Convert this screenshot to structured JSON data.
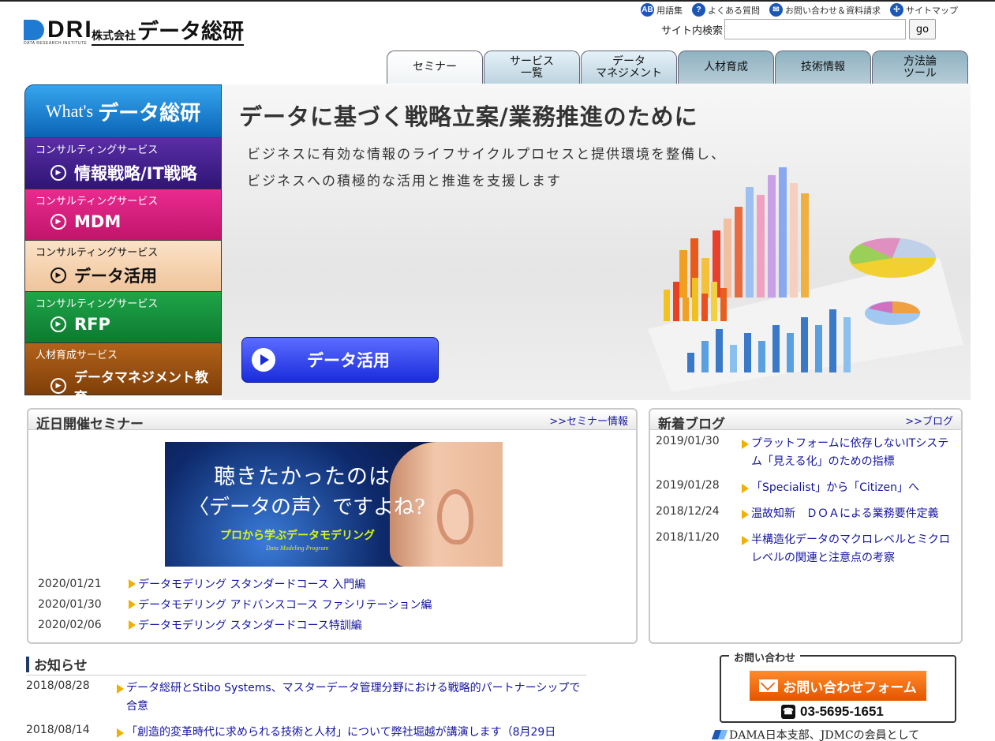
{
  "header": {
    "logo_mark": "DRI",
    "logo_sub": "DATA RESEARCH INSTITUTE",
    "logo_prefix": "株式会社",
    "logo_name": "データ総研",
    "utility": [
      {
        "icon": "ab-glossary-icon",
        "glyph": "AB",
        "label": "用語集"
      },
      {
        "icon": "question-icon",
        "glyph": "?",
        "label": "よくある質問"
      },
      {
        "icon": "mail-icon",
        "glyph": "✉",
        "label": "お問い合わせ＆資料請求"
      },
      {
        "icon": "sitemap-icon",
        "glyph": "✢",
        "label": "サイトマップ"
      }
    ],
    "search": {
      "label": "サイト内検索",
      "value": "",
      "placeholder": "",
      "button": "go"
    }
  },
  "tabs": [
    {
      "label": "セミナー",
      "state": "active"
    },
    {
      "label": "サービス\n一覧",
      "state": "normal"
    },
    {
      "label": "データ\nマネジメント",
      "state": "normal"
    },
    {
      "label": "人材育成",
      "state": "dark"
    },
    {
      "label": "技術情報",
      "state": "dark"
    },
    {
      "label": "方法論\nツール",
      "state": "dark"
    }
  ],
  "leftnav": {
    "whats_prefix": "What's",
    "whats_name": "データ総研",
    "items": [
      {
        "small": "コンサルティングサービス",
        "big": "情報戦略/IT戦略",
        "color": "#3a1f8c"
      },
      {
        "small": "コンサルティングサービス",
        "big": "MDM",
        "color": "#d81b7c"
      },
      {
        "small": "コンサルティングサービス",
        "big": "データ活用",
        "color": "#f5cfa6"
      },
      {
        "small": "コンサルティングサービス",
        "big": "RFP",
        "color": "#169040"
      },
      {
        "small": "人材育成サービス",
        "big": "データマネジメント教育",
        "color": "#9a500f"
      }
    ]
  },
  "hero": {
    "title": "データに基づく戦略立案/業務推進のために",
    "line1": "ビジネスに有効な情報のライフサイクルプロセスと提供環境を整備し、",
    "line2": "ビジネスへの積極的な活用と推進を支援します",
    "button": "データ活用"
  },
  "seminar": {
    "title": "近日開催セミナー",
    "link": ">>セミナー情報",
    "banner": {
      "line1": "聴きたかったのは",
      "line2": "〈データの声〉ですよね?",
      "line3": "プロから学ぶデータモデリング",
      "line4": "Data Modeling Program"
    },
    "items": [
      {
        "date": "2020/01/21",
        "title": "データモデリング スタンダードコース 入門編"
      },
      {
        "date": "2020/01/30",
        "title": "データモデリング アドバンスコース ファシリテーション編"
      },
      {
        "date": "2020/02/06",
        "title": "データモデリング スタンダードコース特訓編"
      }
    ]
  },
  "blog": {
    "title": "新着ブログ",
    "link": ">>ブログ",
    "items": [
      {
        "date": "2019/01/30",
        "title": "プラットフォームに依存しないITシステム「見える化」のための指標"
      },
      {
        "date": "2019/01/28",
        "title": "「Specialist」から「Citizen」へ"
      },
      {
        "date": "2018/12/24",
        "title": "温故知新　ＤＯＡによる業務要件定義"
      },
      {
        "date": "2018/11/20",
        "title": "半構造化データのマクロレベルとミクロレベルの関連と注意点の考察"
      }
    ]
  },
  "news": {
    "title": "お知らせ",
    "items": [
      {
        "date": "2018/08/28",
        "title": "データ総研とStibo Systems、マスターデータ管理分野における戦略的パートナーシップで合意"
      },
      {
        "date": "2018/08/14",
        "title": "「創造的変革時代に求められる技術と人材」について弊社堀越が講演します（8月29日"
      }
    ]
  },
  "contact": {
    "legend": "お問い合わせ",
    "form_button": "お問い合わせフォーム",
    "phone": "03-5695-1651"
  },
  "dama": "DAMA日本支部、JDMCの会員として",
  "colors": {
    "accent_blue": "#1f7bd1",
    "link": "#1414a0",
    "contact_orange": "#ff7a1a"
  }
}
